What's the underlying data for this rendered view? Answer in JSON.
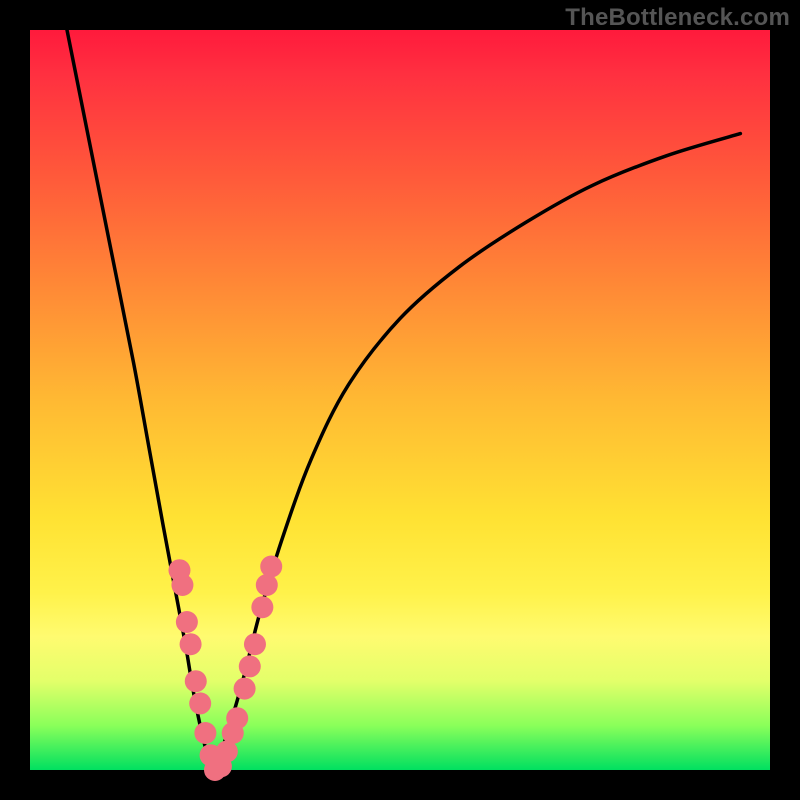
{
  "watermark": "TheBottleneck.com",
  "chart_data": {
    "type": "line",
    "title": "",
    "xlabel": "",
    "ylabel": "",
    "xlim": [
      0,
      100
    ],
    "ylim": [
      0,
      100
    ],
    "series": [
      {
        "name": "curve-left",
        "x": [
          5,
          8,
          11,
          14,
          16,
          18,
          19.5,
          21,
          22,
          23,
          24,
          25
        ],
        "y": [
          100,
          85,
          70,
          55,
          44,
          33,
          25,
          17,
          11,
          6,
          2,
          0
        ]
      },
      {
        "name": "curve-right",
        "x": [
          25,
          27,
          29,
          31,
          34,
          38,
          43,
          50,
          58,
          67,
          76,
          86,
          96
        ],
        "y": [
          0,
          6,
          13,
          21,
          31,
          42,
          52,
          61,
          68,
          74,
          79,
          83,
          86
        ]
      }
    ],
    "markers": [
      {
        "x": 20.2,
        "y": 27
      },
      {
        "x": 20.6,
        "y": 25
      },
      {
        "x": 21.2,
        "y": 20
      },
      {
        "x": 21.7,
        "y": 17
      },
      {
        "x": 22.4,
        "y": 12
      },
      {
        "x": 23.0,
        "y": 9
      },
      {
        "x": 23.7,
        "y": 5
      },
      {
        "x": 24.4,
        "y": 2
      },
      {
        "x": 25.0,
        "y": 0
      },
      {
        "x": 25.8,
        "y": 0.5
      },
      {
        "x": 26.6,
        "y": 2.5
      },
      {
        "x": 27.4,
        "y": 5
      },
      {
        "x": 28.0,
        "y": 7
      },
      {
        "x": 29.0,
        "y": 11
      },
      {
        "x": 29.7,
        "y": 14
      },
      {
        "x": 30.4,
        "y": 17
      },
      {
        "x": 31.4,
        "y": 22
      },
      {
        "x": 32.0,
        "y": 25
      },
      {
        "x": 32.6,
        "y": 27.5
      }
    ],
    "marker_color": "#f07080",
    "curve_color": "#000000"
  }
}
